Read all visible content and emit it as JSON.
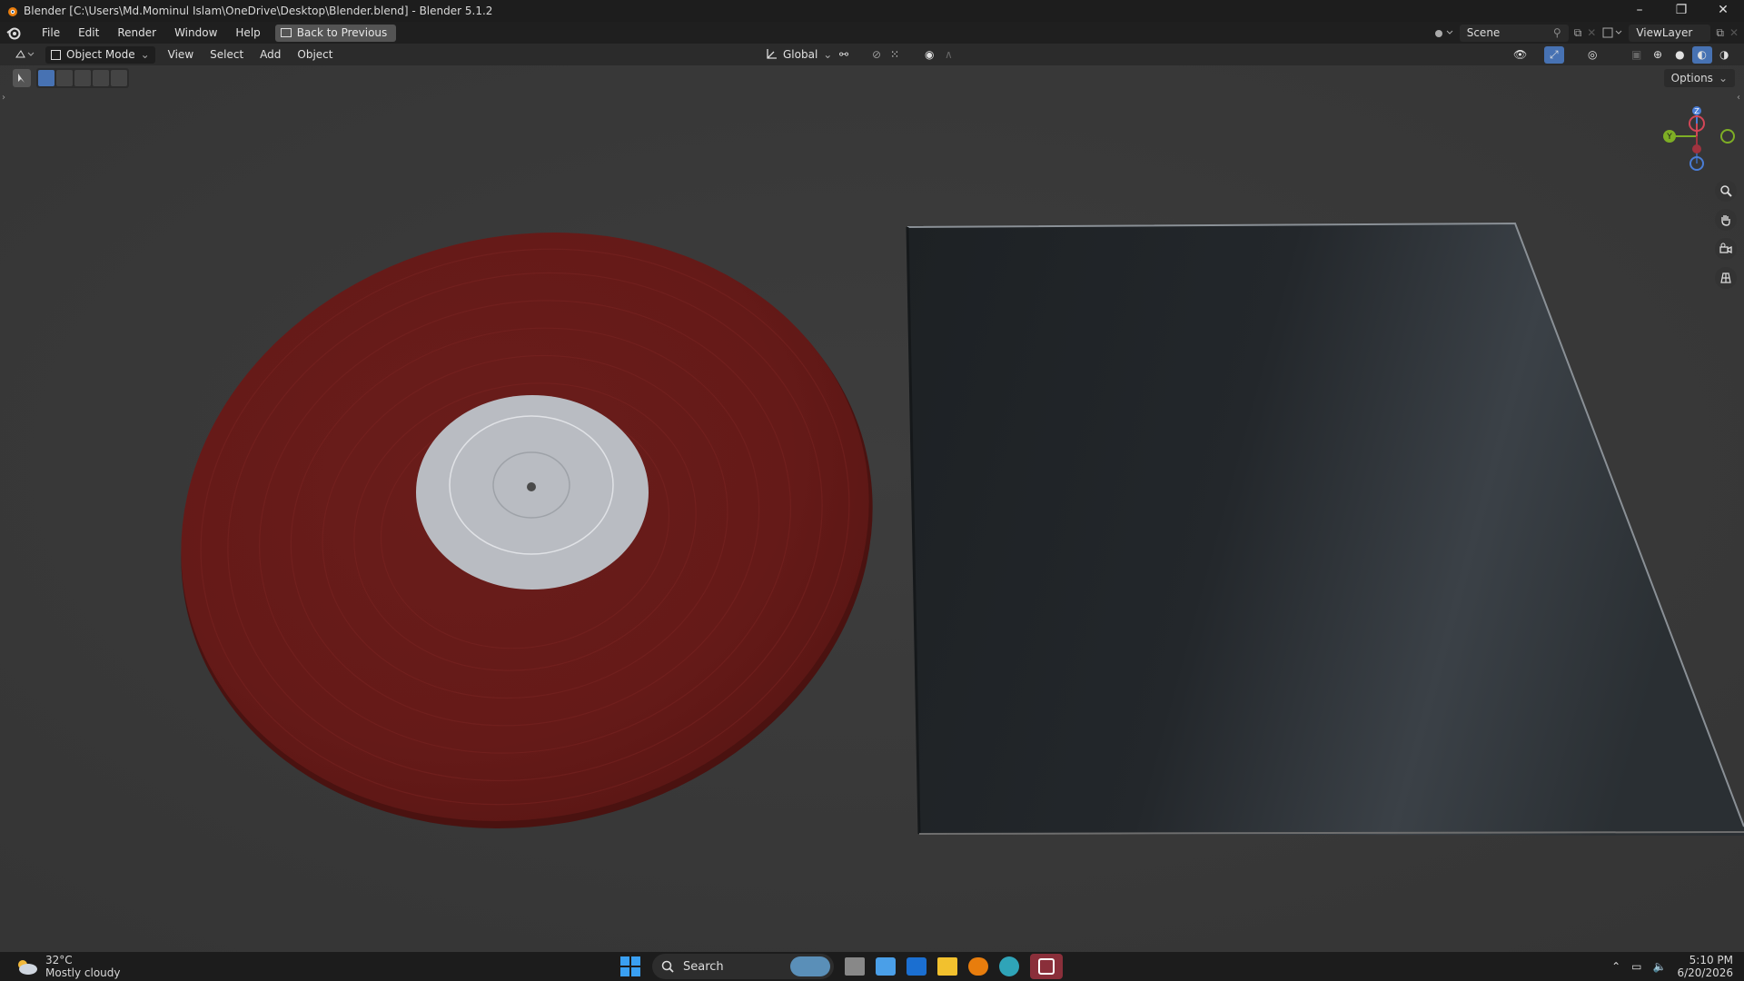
{
  "window": {
    "title": "Blender [C:\\Users\\Md.Mominul Islam\\OneDrive\\Desktop\\Blender.blend] - Blender 5.1.2",
    "minimize": "–",
    "maximize": "❐",
    "close": "✕"
  },
  "menubar": {
    "items": [
      "File",
      "Edit",
      "Render",
      "Window",
      "Help"
    ],
    "back_button": "Back to Previous",
    "scene": "Scene",
    "view_layer": "ViewLayer"
  },
  "header3d": {
    "mode": "Object Mode",
    "menus": [
      "View",
      "Select",
      "Add",
      "Object"
    ],
    "orientation": "Global",
    "options": "Options"
  },
  "gizmo": {
    "x_label": "X",
    "y_label": "Y",
    "z_label": "Z"
  },
  "taskbar": {
    "weather_temp": "32°C",
    "weather_desc": "Mostly cloudy",
    "search_placeholder": "Search",
    "time": "5:10 PM",
    "date": "6/20/2026"
  },
  "colors": {
    "record_red": "#6b1b19",
    "label_gray": "#b9bcc2",
    "sleeve_dark": "#1f2428",
    "accent_blue": "#4772b3"
  }
}
